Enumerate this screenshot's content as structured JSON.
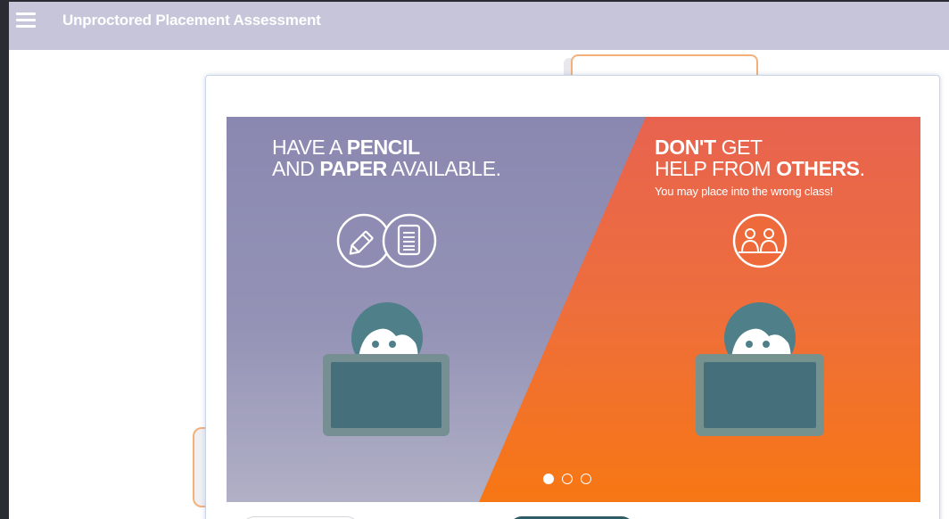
{
  "header": {
    "title": "Unproctored Placement Assessment",
    "menu_icon": "hamburger-menu-icon"
  },
  "slide": {
    "left_panel": {
      "line1_pre": "HAVE A ",
      "line1_bold": "PENCIL",
      "line2_pre": "AND ",
      "line2_bold": "PAPER",
      "line2_post": " AVAILABLE.",
      "icons": [
        "pencil-icon",
        "paper-icon"
      ]
    },
    "right_panel": {
      "line1_bold": "DON'T",
      "line1_post": " GET",
      "line2_pre": "HELP FROM ",
      "line2_bold": "OTHERS",
      "line2_post": ".",
      "subtext": "You may place into the wrong class!",
      "icon": "two-people-icon"
    },
    "carousel": {
      "total": 3,
      "active_index": 0
    }
  },
  "colors": {
    "header_bg": "#c6c5d9",
    "purple_panel": "#8e8cb2",
    "orange_panel": "#ec6b4b",
    "orange_bottom": "#f47a20",
    "face_teal": "#4f7f88",
    "laptop": "#456f7a"
  }
}
